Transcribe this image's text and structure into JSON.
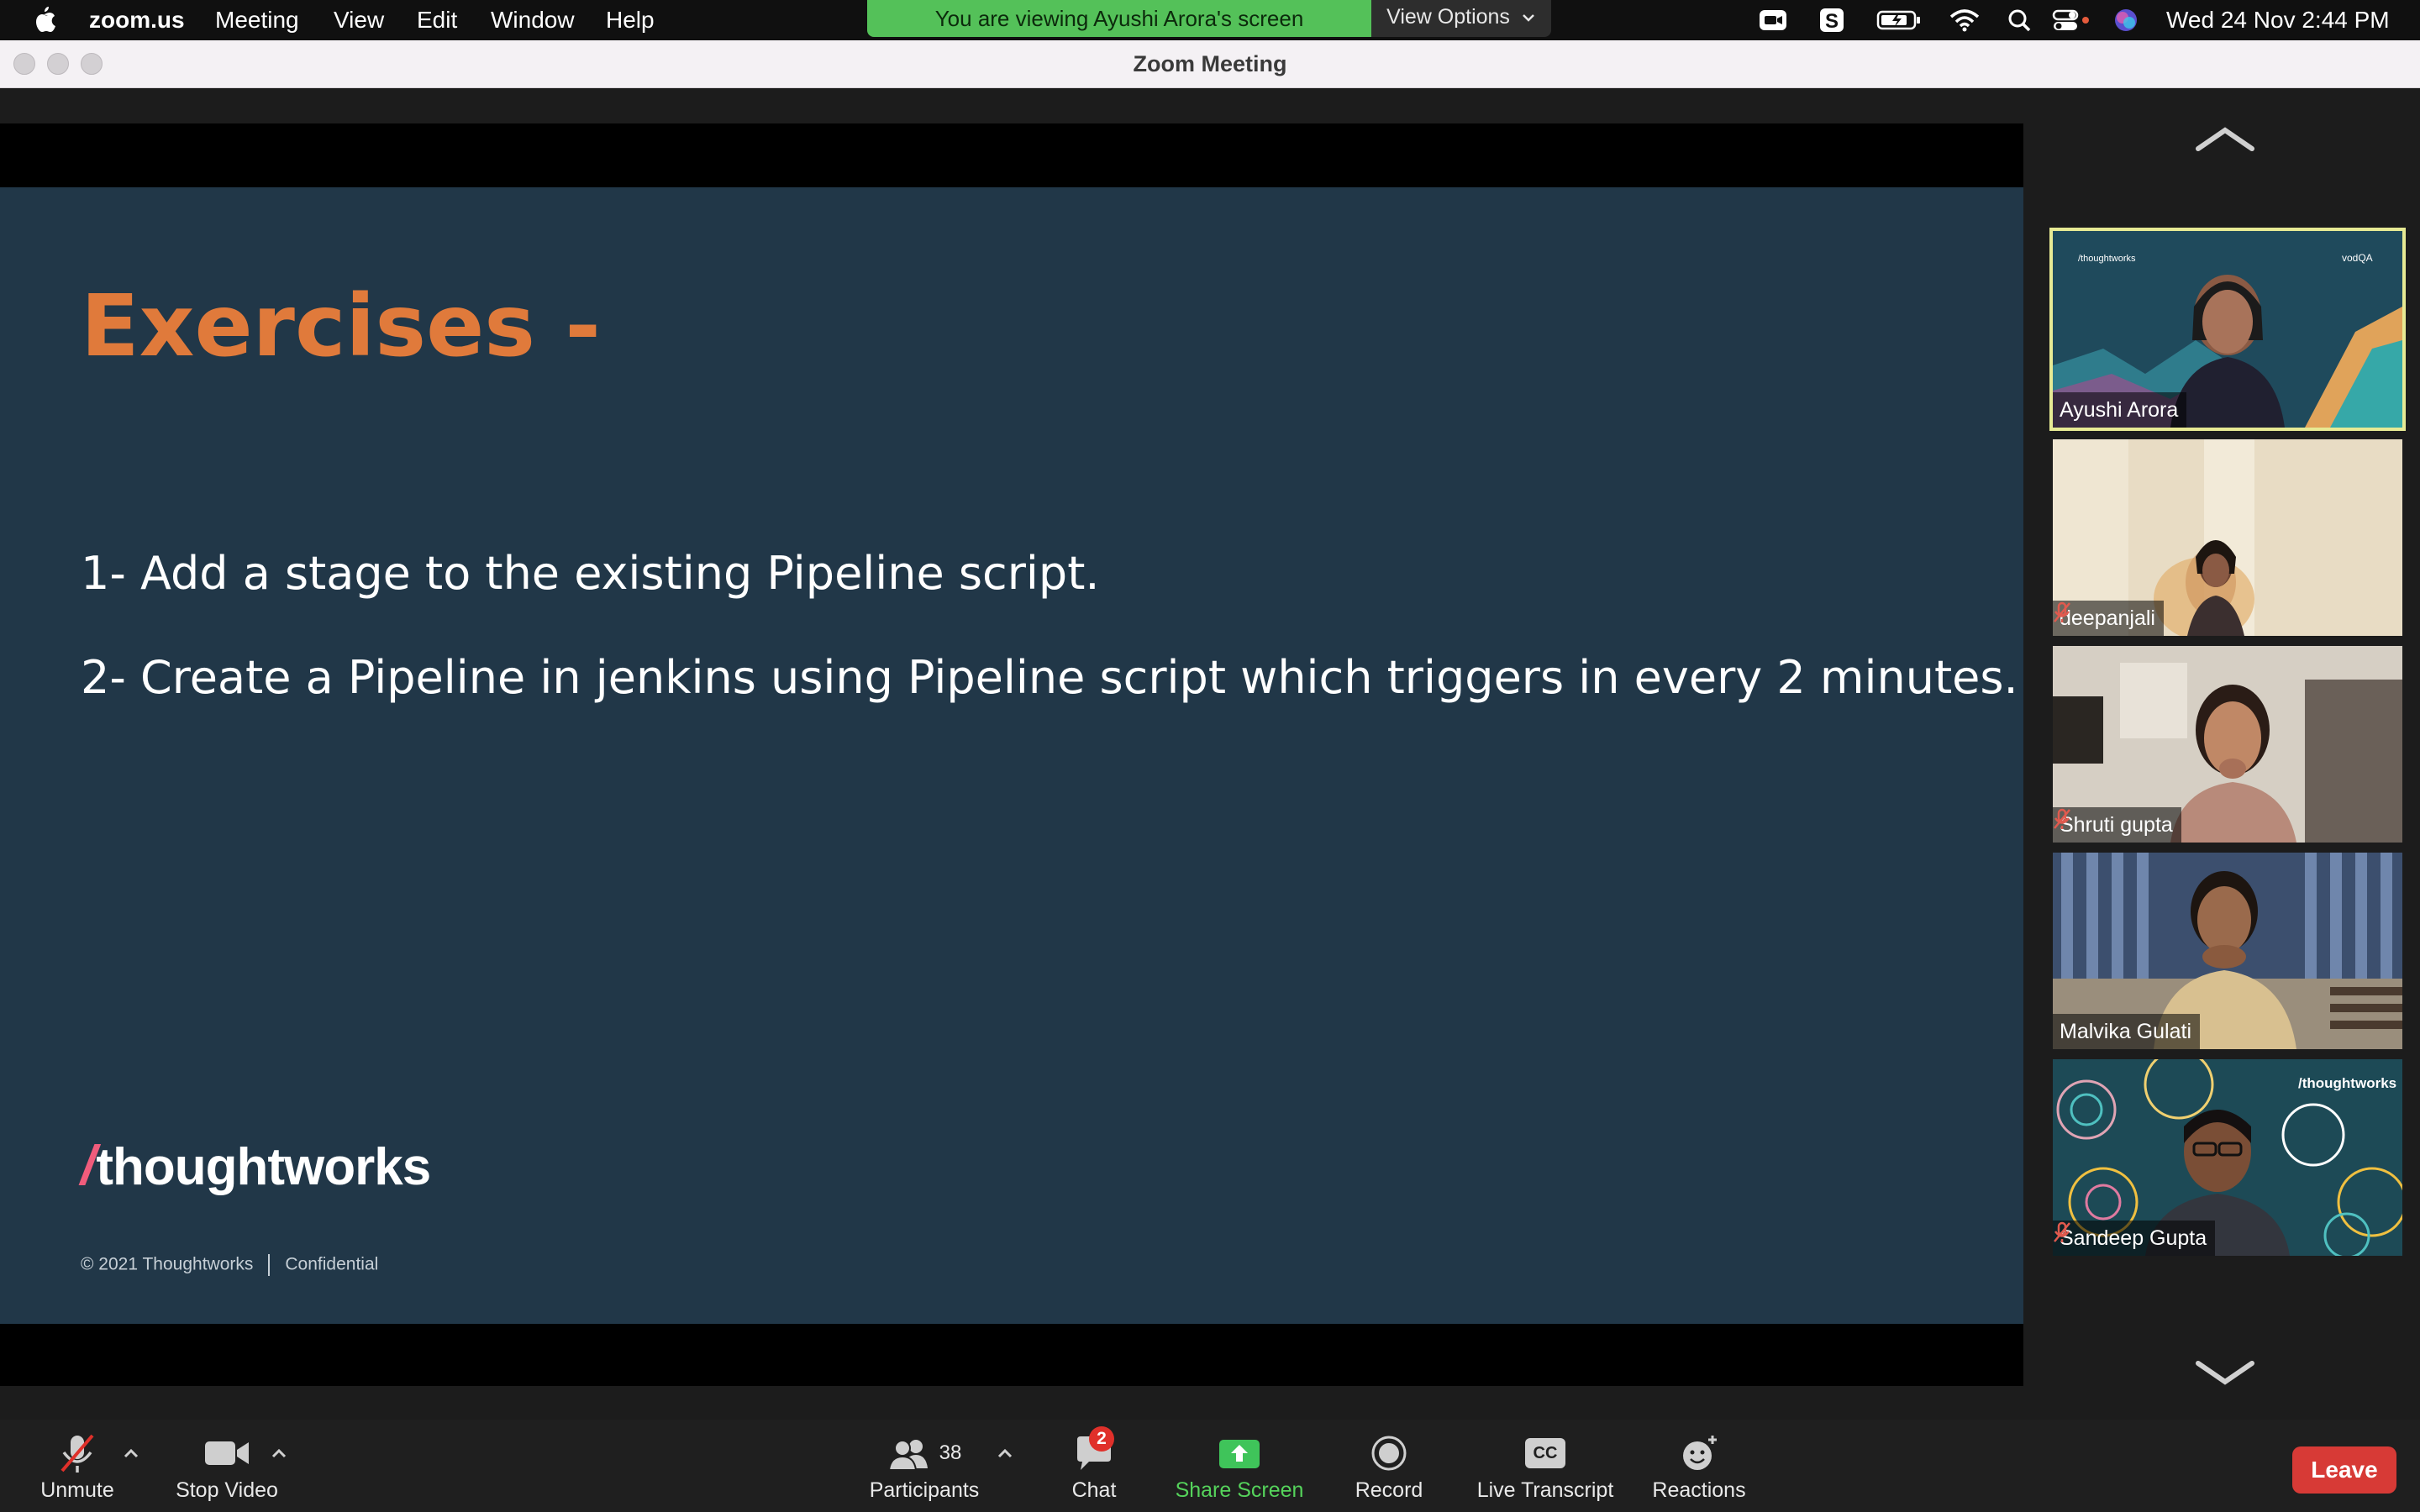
{
  "menubar": {
    "app_name": "zoom.us",
    "items": [
      "Meeting",
      "View",
      "Edit",
      "Window",
      "Help"
    ],
    "share_banner": "You are viewing Ayushi Arora's screen",
    "view_options": "View Options",
    "clock": "Wed 24 Nov  2:44 PM",
    "status_icons": [
      "zoom-icon",
      "s-icon",
      "battery-icon",
      "wifi-icon",
      "search-icon",
      "control-center-icon",
      "siri-icon"
    ]
  },
  "window": {
    "title": "Zoom Meeting"
  },
  "slide": {
    "title": "Exercises -",
    "lines": [
      "1- Add a stage to the existing Pipeline script.",
      "2- Create a Pipeline in jenkins using Pipeline script which triggers in every 2 minutes."
    ],
    "logo_slash": "/",
    "logo_word": "thoughtworks",
    "footer_copyright": "© 2021 Thoughtworks",
    "footer_label": "Confidential",
    "colors": {
      "background": "#213748",
      "title": "#e07a3b",
      "text": "#ffffff"
    }
  },
  "gallery": {
    "participants": [
      {
        "name": "Ayushi Arora",
        "muted": false,
        "active": true
      },
      {
        "name": "deepanjali",
        "muted": true,
        "active": false
      },
      {
        "name": "Shruti gupta",
        "muted": true,
        "active": false
      },
      {
        "name": "Malvika Gulati",
        "muted": false,
        "active": false
      },
      {
        "name": "Sandeep Gupta",
        "muted": true,
        "active": false
      }
    ]
  },
  "toolbar": {
    "unmute": "Unmute",
    "stop_video": "Stop Video",
    "participants": "Participants",
    "participants_count": "38",
    "chat": "Chat",
    "chat_badge": "2",
    "share_screen": "Share Screen",
    "record": "Record",
    "live_transcript": "Live Transcript",
    "cc": "CC",
    "reactions": "Reactions",
    "leave": "Leave"
  }
}
